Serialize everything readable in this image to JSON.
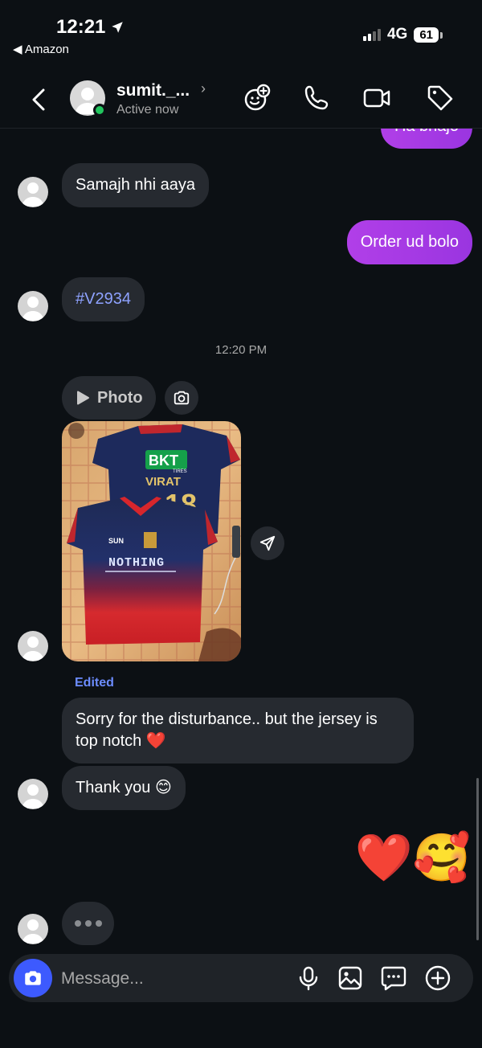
{
  "status_bar": {
    "time": "12:21",
    "back_app": "◀ Amazon",
    "network": "4G",
    "battery": "61"
  },
  "header": {
    "name": "sumit._...",
    "status": "Active now"
  },
  "messages": [
    {
      "side": "out",
      "text": "Ha bhajo"
    },
    {
      "side": "in",
      "text": "Samajh nhi aaya"
    },
    {
      "side": "out",
      "text": "Order ud bolo"
    },
    {
      "side": "in",
      "text": "#V2934"
    }
  ],
  "timestamp": "12:20 PM",
  "photo_label": "Photo",
  "edited_label": "Edited",
  "jersey_texts": {
    "sponsor": "BKT",
    "sponsor_sub": "TIRES",
    "player": "VIRAT",
    "number": "18",
    "front_sponsor": "NOTHING",
    "sun": "SUN"
  },
  "messages_after": [
    {
      "side": "in",
      "text": "Sorry for the disturbance.. but the jersey is top notch ❤️"
    },
    {
      "side": "in",
      "text": "Thank you 😊"
    }
  ],
  "reactions": "❤️🥰",
  "composer": {
    "placeholder": "Message..."
  },
  "colors": {
    "background": "#0c1014",
    "incoming_bubble": "#262a30",
    "outgoing_bubble": "#a33ee6",
    "accent_blue": "#3d5afe",
    "online": "#22c55e"
  }
}
